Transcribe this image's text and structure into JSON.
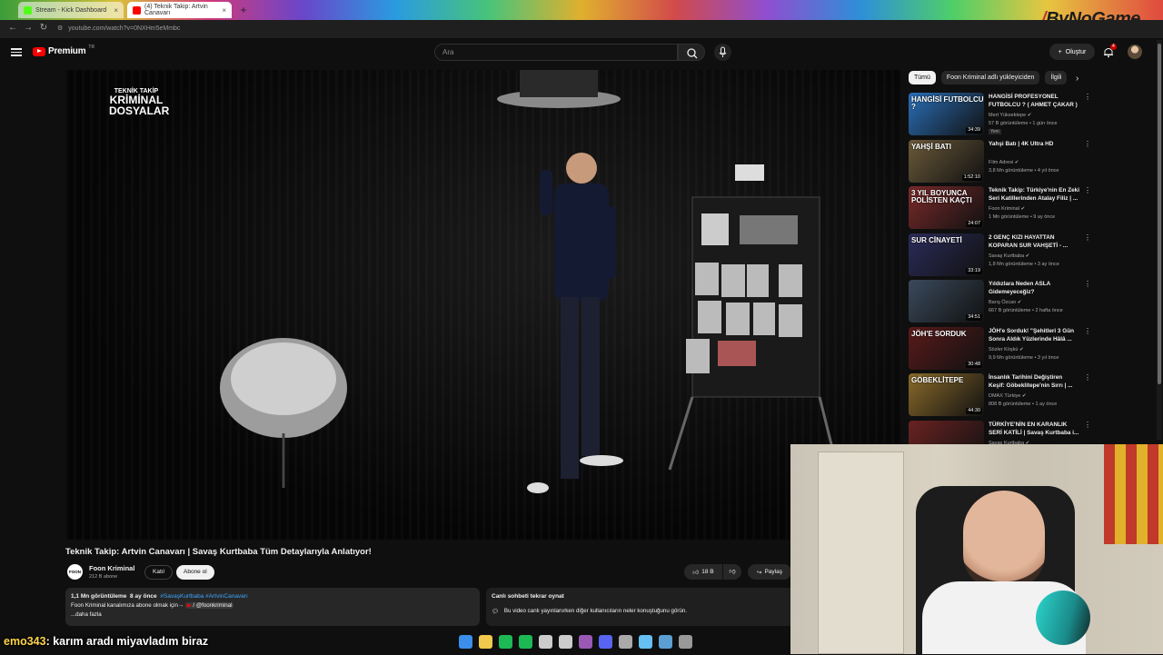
{
  "browser": {
    "tabs": [
      {
        "title": "Stream - Kick Dashboard",
        "favicon_color": "#53fc18",
        "active": false
      },
      {
        "title": "(4) Teknik Takip: Artvin Canavarı",
        "favicon_color": "#ff0000",
        "active": true
      }
    ],
    "url": "youtube.com/watch?v=0NXHm5eMmbc"
  },
  "overlay_brand": "ByNoGame",
  "youtube": {
    "logo_text": "Premium",
    "logo_sup": "TR",
    "search_placeholder": "Ara",
    "create_label": "Oluştur",
    "notification_count": "4"
  },
  "video": {
    "show_logo": [
      "TEKNİK TAKİP",
      "KRİMİNAL",
      "DOSYALAR"
    ],
    "title": "Teknik Takip: Artvin Canavarı | Savaş Kurtbaba Tüm Detaylarıyla Anlatıyor!",
    "channel": {
      "name": "Foon Kriminal",
      "subscribers": "212 B abone",
      "avatar_text": "FOON"
    },
    "join_label": "Katıl",
    "subscribe_label": "Abone ol",
    "likes": "18 B",
    "share_label": "Paylaş",
    "description": {
      "views": "1,1 Mn görüntüleme",
      "age": "8 ay önce",
      "tags": "#SavaşKurtbaba #ArtvinCanavarı",
      "line": "Foon Kriminal kanalımıza abone olmak için→",
      "mention": "/ @foonkriminal",
      "more": "...daha fazla"
    },
    "live_chat": {
      "title": "Canlı sohbeti tekrar oynat",
      "desc": "Bu video canlı yayınlanırken diğer kullanıcıların neler konuştuğunu görün."
    }
  },
  "sidebar": {
    "chips": [
      "Tümü",
      "Foon Kriminal adlı yükleyiciden",
      "İlgili"
    ],
    "recommendations": [
      {
        "title": "HANGİSİ PROFESYONEL FUTBOLCU ? ( AHMET ÇAKAR )",
        "channel": "Mert Yüksektepe",
        "meta": "57 B görüntüleme • 1 gün önce",
        "badge": "Yeni",
        "duration": "34:39",
        "thumb_text": "HANGİSİ FUTBOLCU ?",
        "thumb_color": "#2a6fb8"
      },
      {
        "title": "Yahşi Batı | 4K Ultra HD",
        "channel": "Film Adresi",
        "meta": "3,8 Mn görüntüleme • 4 yıl önce",
        "duration": "1:52:10",
        "thumb_text": "YAHŞİ BATI",
        "thumb_color": "#6b5a3a"
      },
      {
        "title": "Teknik Takip: Türkiye'nin En Zeki Seri Katillerinden Atalay Filiz | ...",
        "channel": "Foon Kriminal",
        "meta": "1 Mn görüntüleme • 9 ay önce",
        "duration": "24:07",
        "thumb_text": "3 YIL BOYUNCA POLİSTEN KAÇTI",
        "thumb_color": "#7a2a2a"
      },
      {
        "title": "2 GENÇ KIZI HAYATTAN KOPARAN SUR VAHŞETİ - ...",
        "channel": "Savaş Kurtbaba",
        "meta": "1,8 Mn görüntüleme • 3 ay önce",
        "duration": "33:19",
        "thumb_text": "SUR CİNAYETİ",
        "thumb_color": "#2b2b5a"
      },
      {
        "title": "Yıldızlara Neden ASLA Gidemeyeceğiz?",
        "channel": "Barış Özcan",
        "meta": "667 B görüntüleme • 2 hafta önce",
        "duration": "34:51",
        "thumb_text": "",
        "thumb_color": "#3a4a5c"
      },
      {
        "title": "JÖH'e Sorduk! \"Şehitleri 3 Gün Sonra Aldık Yüzlerinde Hâlâ ...",
        "channel": "Sözler Köşkü",
        "meta": "9,9 Mn görüntüleme • 3 yıl önce",
        "duration": "30:48",
        "thumb_text": "JÖH'E SORDUK",
        "thumb_color": "#5a1a1a"
      },
      {
        "title": "İnsanlık Tarihini Değiştiren Keşif: Göbeklitepe'nin Sırrı | ...",
        "channel": "DMAX Türkiye",
        "meta": "808 B görüntüleme • 1 ay önce",
        "duration": "44:30",
        "thumb_text": "GÖBEKLİTEPE",
        "thumb_color": "#8a6a2a"
      },
      {
        "title": "TÜRKİYE'NİN EN KARANLIK SERİ KATİLİ | Savaş Kurtbaba i...",
        "channel": "Savaş Kurtbaba",
        "meta": "",
        "duration": "",
        "thumb_text": "",
        "thumb_color": "#6a2222"
      }
    ]
  },
  "stream_chat": {
    "user": "emo343",
    "message": ": karım aradı miyavladım biraz"
  },
  "taskbar_colors": [
    "#3b8eea",
    "#f2c94c",
    "#1db954",
    "#1db954",
    "#cccccc",
    "#cccccc",
    "#9b59b6",
    "#5865f2",
    "#aaaaaa",
    "#66c0f4",
    "#5ca0d3",
    "#999999"
  ]
}
